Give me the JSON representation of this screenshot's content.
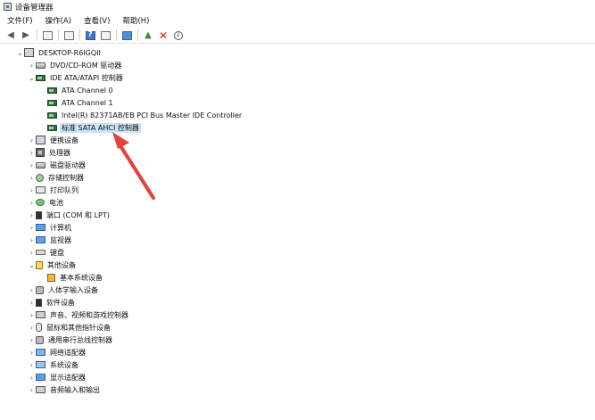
{
  "window": {
    "title": "设备管理器"
  },
  "menu": [
    "文件(F)",
    "操作(A)",
    "查看(V)",
    "帮助(H)"
  ],
  "toolbar": [
    "back",
    "forward",
    "properties",
    "list",
    "help",
    "details",
    "monitor",
    "update-driver",
    "uninstall",
    "scan"
  ],
  "tree": [
    {
      "text": "DESKTOP-R6IGQII",
      "indent": 0,
      "exp": "v",
      "icon": "computer",
      "iconName": "computer-icon",
      "row": 0
    },
    {
      "text": "DVD/CD-ROM 驱动器",
      "indent": 1,
      "exp": ">",
      "icon": "disk",
      "iconName": "dvd-drive-icon",
      "row": 1
    },
    {
      "text": "IDE ATA/ATAPI 控制器",
      "indent": 1,
      "exp": "v",
      "icon": "chip",
      "iconName": "ide-controller-icon",
      "row": 2
    },
    {
      "text": "ATA Channel 0",
      "indent": 2,
      "exp": "",
      "icon": "chip",
      "iconName": "ata-channel-icon",
      "row": 3
    },
    {
      "text": "ATA Channel 1",
      "indent": 2,
      "exp": "",
      "icon": "chip",
      "iconName": "ata-channel-icon",
      "row": 4
    },
    {
      "text": "Intel(R) 82371AB/EB PCI Bus Master IDE Controller",
      "indent": 2,
      "exp": "",
      "icon": "chip",
      "iconName": "ide-controller-icon",
      "row": 5
    },
    {
      "text": "标准 SATA AHCI 控制器",
      "indent": 2,
      "exp": "",
      "icon": "chip",
      "iconName": "sata-controller-icon",
      "row": 6,
      "selected": true
    },
    {
      "text": "便携设备",
      "indent": 1,
      "exp": ">",
      "icon": "computer",
      "iconName": "portable-device-icon",
      "row": 7
    },
    {
      "text": "处理器",
      "indent": 1,
      "exp": ">",
      "icon": "cpu",
      "iconName": "processor-icon",
      "row": 8
    },
    {
      "text": "磁盘驱动器",
      "indent": 1,
      "exp": ">",
      "icon": "disk",
      "iconName": "disk-drive-icon",
      "row": 9
    },
    {
      "text": "存储控制器",
      "indent": 1,
      "exp": ">",
      "icon": "gear",
      "iconName": "storage-controller-icon",
      "row": 10
    },
    {
      "text": "打印队列",
      "indent": 1,
      "exp": ">",
      "icon": "printer",
      "iconName": "printer-icon",
      "row": 11
    },
    {
      "text": "电池",
      "indent": 1,
      "exp": ">",
      "icon": "battery",
      "iconName": "battery-icon",
      "row": 12
    },
    {
      "text": "端口 (COM 和 LPT)",
      "indent": 1,
      "exp": ">",
      "icon": "port",
      "iconName": "port-icon",
      "row": 13
    },
    {
      "text": "计算机",
      "indent": 1,
      "exp": ">",
      "icon": "monitor",
      "iconName": "computer-icon",
      "row": 14
    },
    {
      "text": "监视器",
      "indent": 1,
      "exp": ">",
      "icon": "monitor",
      "iconName": "monitor-icon",
      "row": 15
    },
    {
      "text": "键盘",
      "indent": 1,
      "exp": ">",
      "icon": "keyboard",
      "iconName": "keyboard-icon",
      "row": 16
    },
    {
      "text": "其他设备",
      "indent": 1,
      "exp": "v",
      "icon": "unknown",
      "iconName": "other-device-icon",
      "row": 17
    },
    {
      "text": "基本系统设备",
      "indent": 2,
      "exp": "",
      "icon": "warn",
      "iconName": "warning-device-icon",
      "row": 18
    },
    {
      "text": "人体学输入设备",
      "indent": 1,
      "exp": ">",
      "icon": "hid",
      "iconName": "hid-icon",
      "row": 19
    },
    {
      "text": "软件设备",
      "indent": 1,
      "exp": ">",
      "icon": "port",
      "iconName": "software-device-icon",
      "row": 20
    },
    {
      "text": "声音、视频和游戏控制器",
      "indent": 1,
      "exp": ">",
      "icon": "speaker",
      "iconName": "speaker-icon",
      "row": 21
    },
    {
      "text": "鼠标和其他指针设备",
      "indent": 1,
      "exp": ">",
      "icon": "mouse",
      "iconName": "mouse-icon",
      "row": 22
    },
    {
      "text": "通用串行总线控制器",
      "indent": 1,
      "exp": ">",
      "icon": "hid",
      "iconName": "usb-icon",
      "row": 23
    },
    {
      "text": "网络适配器",
      "indent": 1,
      "exp": ">",
      "icon": "network",
      "iconName": "network-adapter-icon",
      "row": 24
    },
    {
      "text": "系统设备",
      "indent": 1,
      "exp": ">",
      "icon": "folder",
      "iconName": "system-device-icon",
      "row": 25
    },
    {
      "text": "显示适配器",
      "indent": 1,
      "exp": ">",
      "icon": "monitor",
      "iconName": "display-adapter-icon",
      "row": 26
    },
    {
      "text": "音频输入和输出",
      "indent": 1,
      "exp": ">",
      "icon": "speaker",
      "iconName": "audio-io-icon",
      "row": 27
    }
  ],
  "annotation": {
    "color": "#e8403b"
  }
}
